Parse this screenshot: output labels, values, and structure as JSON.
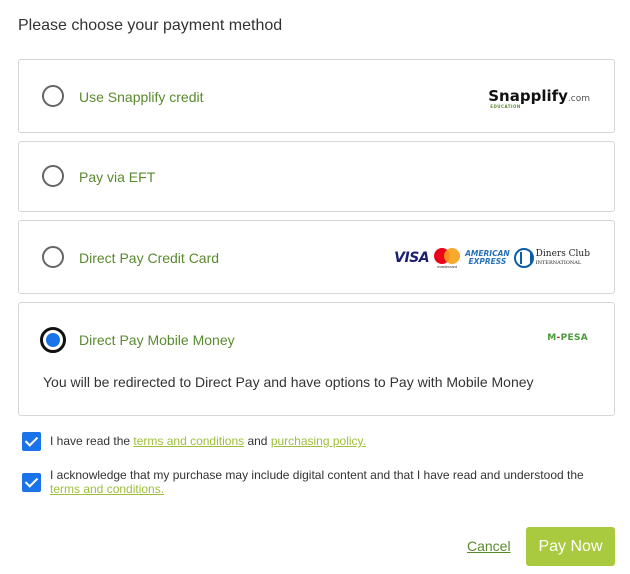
{
  "heading": "Please choose your payment method",
  "options": [
    {
      "label": "Use Snapplify credit",
      "selected": false,
      "logo": {
        "name": "Snapplify",
        "suffix": ".com",
        "sub": "EDUCATION"
      }
    },
    {
      "label": "Pay via EFT",
      "selected": false
    },
    {
      "label": "Direct Pay Credit Card",
      "selected": false,
      "logos": {
        "visa": "VISA",
        "mastercard": "mastercard",
        "amex_line1": "AMERICAN",
        "amex_line2": "EXPRESS",
        "diners_line1": "Diners Club",
        "diners_line2": "INTERNATIONAL"
      }
    },
    {
      "label": "Direct Pay Mobile Money",
      "selected": true,
      "logo": {
        "m": "M",
        "dash": "-",
        "pesa": "PESA"
      },
      "note": "You will be redirected to Direct Pay and have options to Pay with Mobile Money"
    }
  ],
  "checks": {
    "terms": {
      "checked": true,
      "prefix": "I have read the ",
      "link1": "terms and conditions",
      "middle": " and ",
      "link2": "purchasing policy."
    },
    "digital": {
      "checked": true,
      "prefix": "I acknowledge that my purchase may include digital content and that I have read and understood the ",
      "link": "terms and conditions."
    }
  },
  "actions": {
    "cancel": "Cancel",
    "pay": "Pay Now"
  },
  "colors": {
    "accent_green": "#5a8a2e",
    "button_green": "#a9c93f",
    "link_green": "#9dbf3a",
    "checkbox_blue": "#1a73e8"
  }
}
